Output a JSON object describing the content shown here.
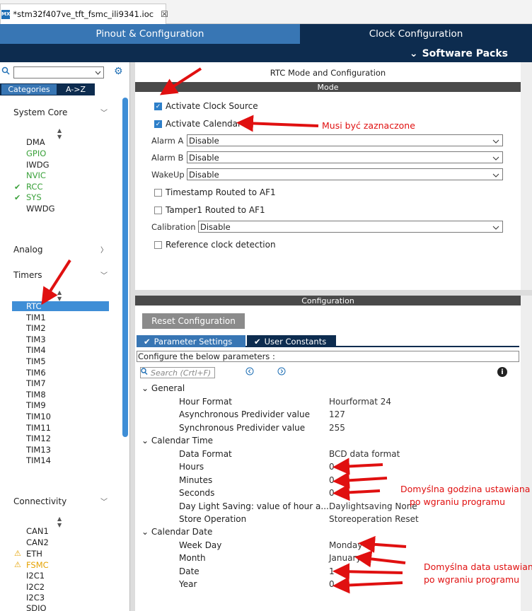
{
  "tab": {
    "title": "*stm32f407ve_tft_fsmc_ili9341.ioc",
    "close": "☒",
    "logo": "MX"
  },
  "header": {
    "pinout": "Pinout & Configuration",
    "clock": "Clock Configuration",
    "software_packs": "Software Packs"
  },
  "left": {
    "tabs": {
      "categories": "Categories",
      "az": "A->Z"
    },
    "sections": {
      "system_core": "System Core",
      "analog": "Analog",
      "timers": "Timers",
      "connectivity": "Connectivity"
    },
    "system_core_items": [
      "DMA",
      "GPIO",
      "IWDG",
      "NVIC",
      "RCC",
      "SYS",
      "WWDG"
    ],
    "timers_items": [
      "RTC",
      "TIM1",
      "TIM2",
      "TIM3",
      "TIM4",
      "TIM5",
      "TIM6",
      "TIM7",
      "TIM8",
      "TIM9",
      "TIM10",
      "TIM11",
      "TIM12",
      "TIM13",
      "TIM14"
    ],
    "connectivity_items": [
      "CAN1",
      "CAN2",
      "ETH",
      "FSMC",
      "I2C1",
      "I2C2",
      "I2C3",
      "SDIO"
    ]
  },
  "mode": {
    "title": "RTC Mode and Configuration",
    "bar": "Mode",
    "activate_clock": "Activate Clock Source",
    "activate_calendar": "Activate Calendar",
    "alarm_a_label": "Alarm A",
    "alarm_a_value": "Disable",
    "alarm_b_label": "Alarm B",
    "alarm_b_value": "Disable",
    "wakeup_label": "WakeUp",
    "wakeup_value": "Disable",
    "timestamp": "Timestamp Routed to AF1",
    "tamper": "Tamper1 Routed to AF1",
    "calibration_label": "Calibration",
    "calibration_value": "Disable",
    "refclock": "Reference clock detection"
  },
  "config": {
    "bar": "Configuration",
    "reset": "Reset Configuration",
    "tab_params": "Parameter Settings",
    "tab_user": "User Constants",
    "configure_below": "Configure the below parameters :",
    "search_placeholder": "Search (Crtl+F)",
    "groups": {
      "general": "General",
      "calendar_time": "Calendar Time",
      "calendar_date": "Calendar Date"
    },
    "general": [
      {
        "k": "Hour Format",
        "v": "Hourformat 24"
      },
      {
        "k": "Asynchronous Predivider value",
        "v": "127"
      },
      {
        "k": "Synchronous Predivider value",
        "v": "255"
      }
    ],
    "calendar_time": [
      {
        "k": "Data Format",
        "v": "BCD data format"
      },
      {
        "k": "Hours",
        "v": "0"
      },
      {
        "k": "Minutes",
        "v": "0"
      },
      {
        "k": "Seconds",
        "v": "0"
      },
      {
        "k": "Day Light Saving: value of hour a...",
        "v": "Daylightsaving None"
      },
      {
        "k": "Store Operation",
        "v": "Storeoperation Reset"
      }
    ],
    "calendar_date": [
      {
        "k": "Week Day",
        "v": "Monday"
      },
      {
        "k": "Month",
        "v": "January"
      },
      {
        "k": "Date",
        "v": "1"
      },
      {
        "k": "Year",
        "v": "0"
      }
    ]
  },
  "annotations": {
    "calendar_note": "Musi być zaznaczone",
    "time_note_1": "Domyślna godzina ustawiana",
    "time_note_2": "po wgraniu programu",
    "date_note_1": "Domyślna data ustawiana",
    "date_note_2": "po wgraniu programu"
  },
  "colors": {
    "header": "#0d2c4f",
    "accent": "#3876b4",
    "annotation": "#e01010"
  }
}
